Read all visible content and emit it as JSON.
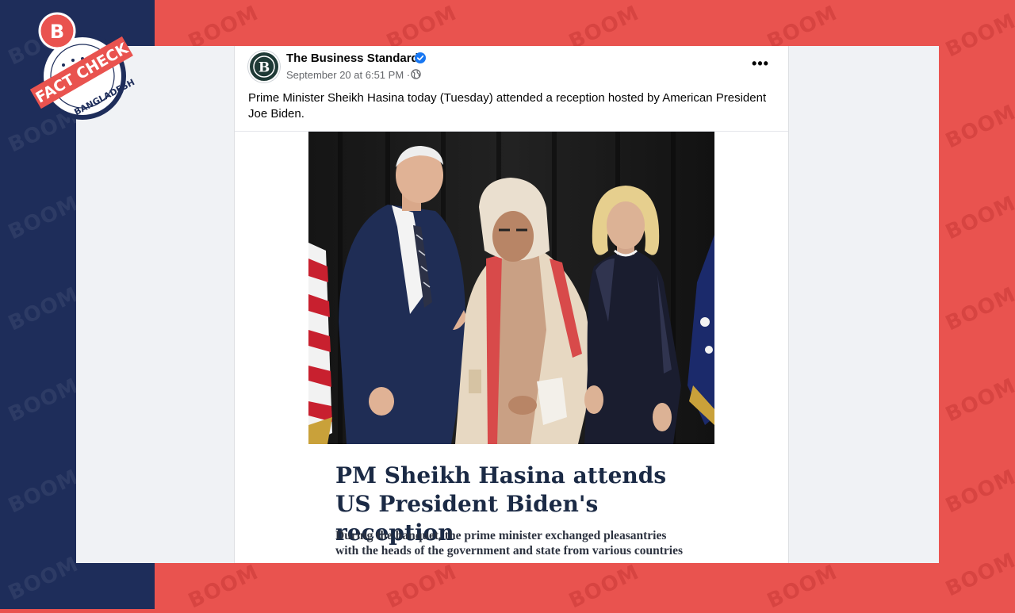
{
  "post": {
    "page_name": "The Business Standard",
    "verified_icon": "verified-badge-icon",
    "timestamp": "September 20 at 6:51 PM",
    "separator": "·",
    "audience_icon": "globe-icon",
    "more_icon": "more-options-icon",
    "more_label": "•••",
    "caption": "Prime Minister Sheikh Hasina today (Tuesday) attended a reception hosted by American President Joe Biden.",
    "headline_line1": "PM Sheikh Hasina attends",
    "headline_line2": "US President Biden's reception",
    "subhead_line1": "During the banquet, the prime minister exchanged pleasantries",
    "subhead_line2": "with the heads of the government and state from various countries"
  },
  "badge": {
    "letter": "B",
    "label": "FACT CHECK",
    "country": "BANGLADESH"
  },
  "watermark": "BOOM",
  "colors": {
    "navy": "#1e2d5a",
    "red": "#e9534f",
    "fb_blue": "#1877f2",
    "headline": "#1b2a45"
  }
}
